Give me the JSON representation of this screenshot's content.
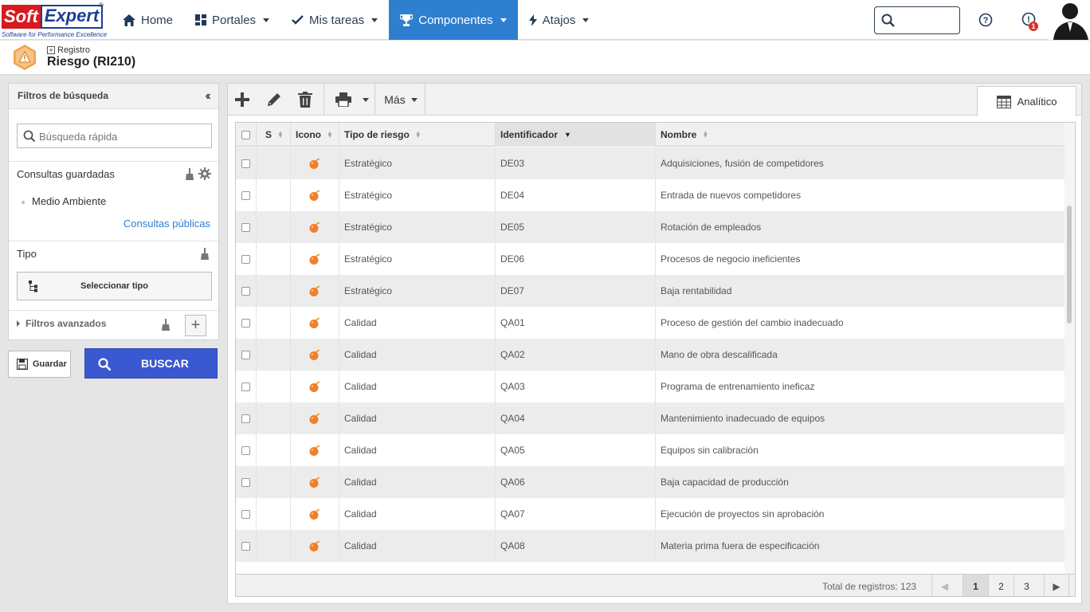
{
  "app": {
    "logo_soft": "Soft",
    "logo_expert": "Expert",
    "logo_tagline": "Software for Performance Excellence",
    "logo_reg": "®"
  },
  "nav": {
    "home": "Home",
    "portales": "Portales",
    "mis_tareas": "Mis tareas",
    "componentes": "Componentes",
    "atajos": "Atajos",
    "notifications_count": "1"
  },
  "header": {
    "breadcrumb": "Registro",
    "title": "Riesgo (RI210)"
  },
  "filters": {
    "title": "Filtros de búsqueda",
    "quick_search_placeholder": "Búsqueda rápida",
    "saved_queries_title": "Consultas guardadas",
    "saved_items": [
      "Medio Ambiente"
    ],
    "public_queries_link": "Consultas públicas",
    "type_title": "Tipo",
    "select_type_button": "Seleccionar tipo",
    "advanced_filters": "Filtros avanzados",
    "save_button": "Guardar",
    "search_button": "BUSCAR"
  },
  "toolbar": {
    "more_label": "Más",
    "view_tab": "Analítico"
  },
  "table": {
    "columns": [
      "S",
      "Icono",
      "Tipo de riesgo",
      "Identificador",
      "Nombre"
    ],
    "rows": [
      {
        "type": "Estratégico",
        "id": "DE03",
        "name": "Adquisiciones, fusión de competidores"
      },
      {
        "type": "Estratégico",
        "id": "DE04",
        "name": "Entrada de nuevos competidores"
      },
      {
        "type": "Estratégico",
        "id": "DE05",
        "name": "Rotación de empleados"
      },
      {
        "type": "Estratégico",
        "id": "DE06",
        "name": "Procesos de negocio ineficientes"
      },
      {
        "type": "Estratégico",
        "id": "DE07",
        "name": "Baja rentabilidad"
      },
      {
        "type": "Calidad",
        "id": "QA01",
        "name": "Proceso de gestión del cambio inadecuado"
      },
      {
        "type": "Calidad",
        "id": "QA02",
        "name": "Mano de obra descalificada"
      },
      {
        "type": "Calidad",
        "id": "QA03",
        "name": "Programa de entrenamiento ineficaz"
      },
      {
        "type": "Calidad",
        "id": "QA04",
        "name": "Mantenimiento inadecuado de equipos"
      },
      {
        "type": "Calidad",
        "id": "QA05",
        "name": "Equipos sin calibración"
      },
      {
        "type": "Calidad",
        "id": "QA06",
        "name": "Baja capacidad de producción"
      },
      {
        "type": "Calidad",
        "id": "QA07",
        "name": "Ejecución de proyectos sin aprobación"
      },
      {
        "type": "Calidad",
        "id": "QA08",
        "name": "Materia prima fuera de especificación"
      }
    ],
    "total_label": "Total de registros: 123",
    "pages": [
      "1",
      "2",
      "3"
    ],
    "current_page": "1"
  },
  "colors": {
    "accent": "#2f7fd1",
    "search_button": "#3a58d0",
    "risk_icon": "#f07f2a"
  }
}
